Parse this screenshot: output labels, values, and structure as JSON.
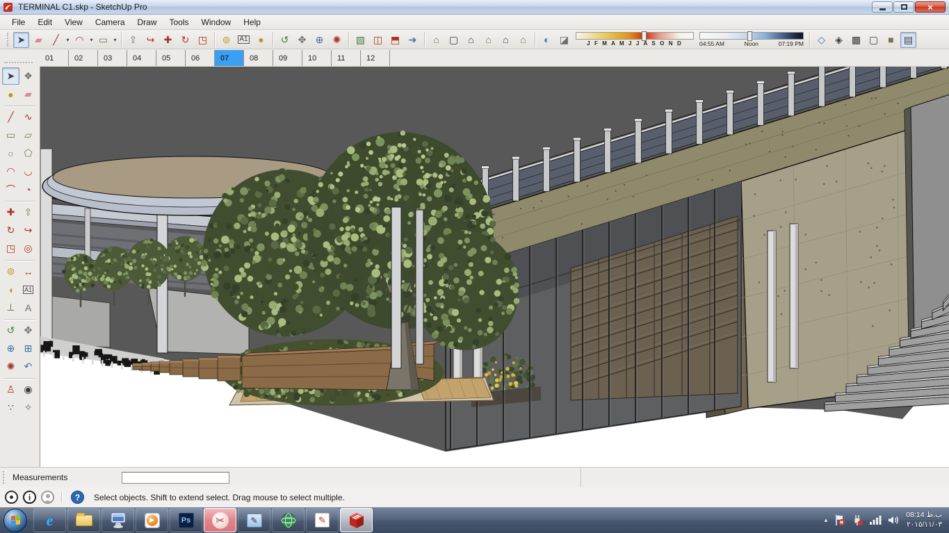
{
  "window": {
    "title": "TERMINAL C1.skp - SketchUp Pro"
  },
  "menu": {
    "items": [
      "File",
      "Edit",
      "View",
      "Camera",
      "Draw",
      "Tools",
      "Window",
      "Help"
    ]
  },
  "shadow_toolbar": {
    "months": "J F M A M J J A S O N D",
    "time_start": "04:55 AM",
    "time_mid": "Noon",
    "time_end": "07:19 PM"
  },
  "scene_tabs": [
    "01",
    "02",
    "03",
    "04",
    "05",
    "06",
    "07",
    "08",
    "09",
    "10",
    "11",
    "12"
  ],
  "measurements": {
    "label": "Measurements",
    "value": ""
  },
  "status": {
    "message": "Select objects. Shift to extend select. Drag mouse to select multiple."
  },
  "tray": {
    "time": "08:14 ب.ظ",
    "date": "٢٠١٥/١١/٠٣"
  },
  "icons": {
    "select": "➤",
    "make_component": "❖",
    "paint": "●",
    "eraser": "▰",
    "line": "╱",
    "freehand": "∿",
    "rectangle": "▭",
    "rotated_rectangle": "▱",
    "circle": "○",
    "polygon": "⬠",
    "arc": "◠",
    "arc2": "◡",
    "arc3": "⌒",
    "pie": "◔",
    "move": "✚",
    "push_pull": "⇧",
    "rotate": "↻",
    "follow_me": "↪",
    "scale": "◳",
    "offset": "◎",
    "tape": "⊚",
    "dimension": "↔",
    "protractor": "◖",
    "text": "A1",
    "axes": "⊥",
    "text3d": "A",
    "orbit": "↺",
    "pan": "✥",
    "zoom": "⊕",
    "zoom_window": "⊞",
    "zoom_extents": "✺",
    "zoom_previous": "↶",
    "position_camera": "♙",
    "look_around": "◉",
    "walk": "∵",
    "section_plane": "✧",
    "add_location": "▧",
    "get_models": "◫",
    "share_model": "⬒",
    "send_layout": "➔",
    "view_iso": "⌂",
    "view_top": "▢",
    "view_front": "⌂",
    "view_right": "⌂",
    "view_back": "⌂",
    "view_left": "⌂",
    "shadow_dialog": "◐",
    "shadow_toggle": "◪",
    "xray": "◇",
    "back_edges": "◈",
    "wireframe": "▩",
    "hidden_line": "▢",
    "shaded": "■",
    "shaded_textures": "▤",
    "dropdown": "▾",
    "chevron_up": "▴",
    "ie": "e",
    "play": "▶",
    "ps": "Ps",
    "scissors": "✂",
    "pencil": "✎",
    "close": "×"
  }
}
